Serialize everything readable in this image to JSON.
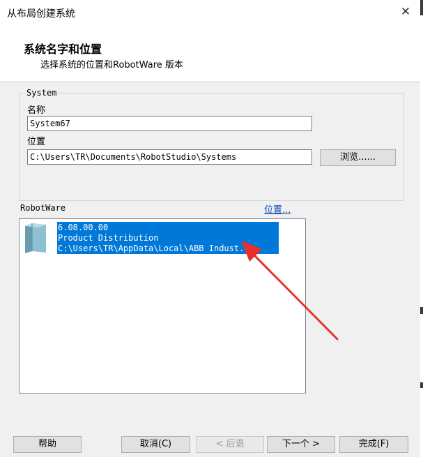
{
  "window": {
    "title": "从布局创建系统",
    "close_glyph": "✕"
  },
  "header": {
    "title": "系统名字和位置",
    "subtitle": "选择系统的位置和RobotWare 版本"
  },
  "system_group": {
    "label": "System",
    "name_label": "名称",
    "name_value": "System67",
    "location_label": "位置",
    "location_value": "C:\\Users\\TR\\Documents\\RobotStudio\\Systems",
    "browse_label": "浏览......"
  },
  "robotware": {
    "label": "RobotWare",
    "location_link": "位置...",
    "items": [
      {
        "icon": "folder-icon",
        "version": "6.08.00.00",
        "distribution": "Product Distribution",
        "path": "C:\\Users\\TR\\AppData\\Local\\ABB Indust..."
      }
    ]
  },
  "footer": {
    "help": "帮助",
    "cancel": "取消(C)",
    "back": "< 后退",
    "next": "下一个 >",
    "finish": "完成(F)"
  },
  "colors": {
    "selection": "#0078d7",
    "annotation_arrow": "#e8302a",
    "link": "#0645ad"
  }
}
